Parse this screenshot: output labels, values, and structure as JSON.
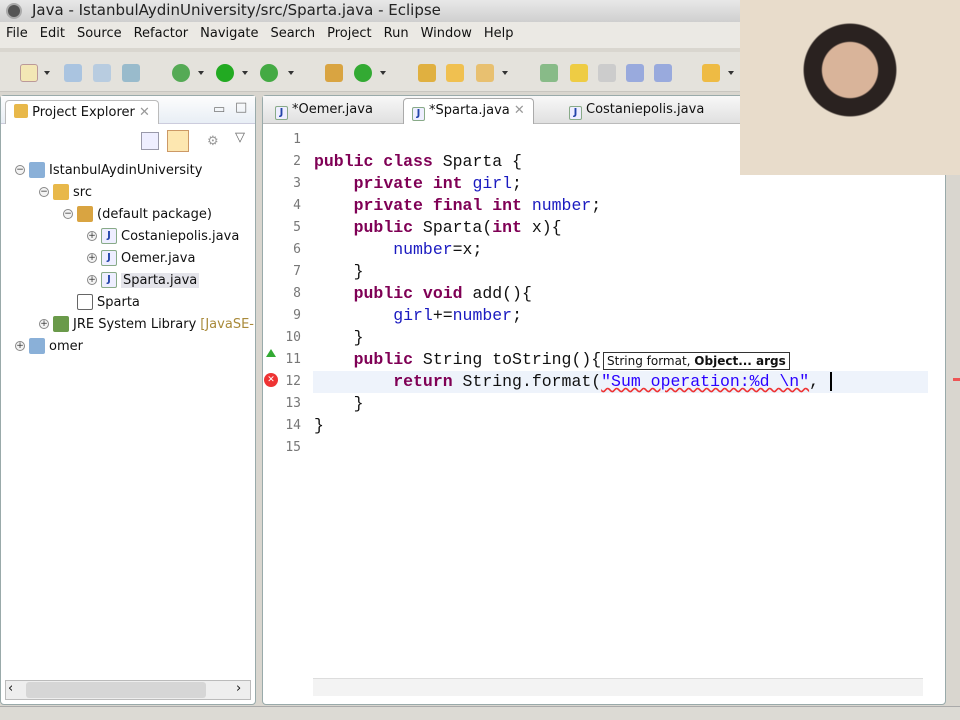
{
  "window": {
    "title": "Java - IstanbulAydinUniversity/src/Sparta.java - Eclipse"
  },
  "menu": [
    "File",
    "Edit",
    "Source",
    "Refactor",
    "Navigate",
    "Search",
    "Project",
    "Run",
    "Window",
    "Help"
  ],
  "project_explorer": {
    "title": "Project Explorer",
    "tree": [
      {
        "label": "IstanbulAydinUniversity",
        "level": 0,
        "expanded": true,
        "icon": "project-icon"
      },
      {
        "label": "src",
        "level": 1,
        "expanded": true,
        "icon": "source-folder-icon"
      },
      {
        "label": "(default package)",
        "level": 2,
        "expanded": true,
        "icon": "package-icon"
      },
      {
        "label": "Costaniepolis.java",
        "level": 3,
        "expanded": false,
        "icon": "java-file-icon"
      },
      {
        "label": "Oemer.java",
        "level": 3,
        "expanded": false,
        "icon": "java-file-icon"
      },
      {
        "label": "Sparta.java",
        "level": 3,
        "expanded": false,
        "icon": "java-file-icon",
        "selected": true
      },
      {
        "label": "Sparta",
        "level": 2,
        "icon": "class-icon"
      },
      {
        "label": "JRE System Library",
        "suffix": "[JavaSE-",
        "level": 1,
        "expanded": false,
        "icon": "library-icon"
      },
      {
        "label": "omer",
        "level": 0,
        "expanded": false,
        "icon": "project-icon"
      }
    ]
  },
  "editor": {
    "tabs": [
      {
        "label": "*Oemer.java"
      },
      {
        "label": "*Sparta.java",
        "active": true
      },
      {
        "label": "Costaniepolis.java"
      }
    ],
    "line_numbers": [
      "1",
      "2",
      "3",
      "4",
      "5",
      "6",
      "7",
      "8",
      "9",
      "10",
      "11",
      "12",
      "13",
      "14",
      "15"
    ],
    "lines": [
      [],
      [
        [
          "kw",
          "public class "
        ],
        [
          "",
          "Sparta {"
        ]
      ],
      [
        [
          "",
          "    "
        ],
        [
          "kw",
          "private int "
        ],
        [
          "fld",
          "girl"
        ],
        [
          "",
          ";"
        ]
      ],
      [
        [
          "",
          "    "
        ],
        [
          "kw",
          "private final int "
        ],
        [
          "fld",
          "number"
        ],
        [
          "",
          ";"
        ]
      ],
      [
        [
          "",
          "    "
        ],
        [
          "kw",
          "public "
        ],
        [
          "",
          "Sparta("
        ],
        [
          "kw",
          "int "
        ],
        [
          "",
          "x){"
        ]
      ],
      [
        [
          "",
          "        "
        ],
        [
          "fld",
          "number"
        ],
        [
          "",
          "=x;"
        ]
      ],
      [
        [
          "",
          "    }"
        ]
      ],
      [
        [
          "",
          "    "
        ],
        [
          "kw",
          "public void "
        ],
        [
          "",
          "add(){"
        ]
      ],
      [
        [
          "",
          "        "
        ],
        [
          "fld",
          "girl"
        ],
        [
          "",
          "+="
        ],
        [
          "fld",
          "number"
        ],
        [
          "",
          ";"
        ]
      ],
      [
        [
          "",
          "    }"
        ]
      ],
      [
        [
          "",
          "    "
        ],
        [
          "kw",
          "public "
        ],
        [
          "",
          "String toString(){"
        ]
      ],
      [
        [
          "",
          "        "
        ],
        [
          "kw",
          "return "
        ],
        [
          "",
          "String.format("
        ],
        [
          "str",
          "\"Sum operation:%d \\n\""
        ],
        [
          "",
          ", "
        ]
      ],
      [
        [
          "",
          "    }"
        ]
      ],
      [
        [
          "",
          "}"
        ]
      ],
      []
    ],
    "param_hint": {
      "plain": "String format, ",
      "bold": "Object... args"
    }
  },
  "colors": {
    "keyword": "#7f0055",
    "field": "#1a1ac0",
    "string": "#2a00ff"
  }
}
